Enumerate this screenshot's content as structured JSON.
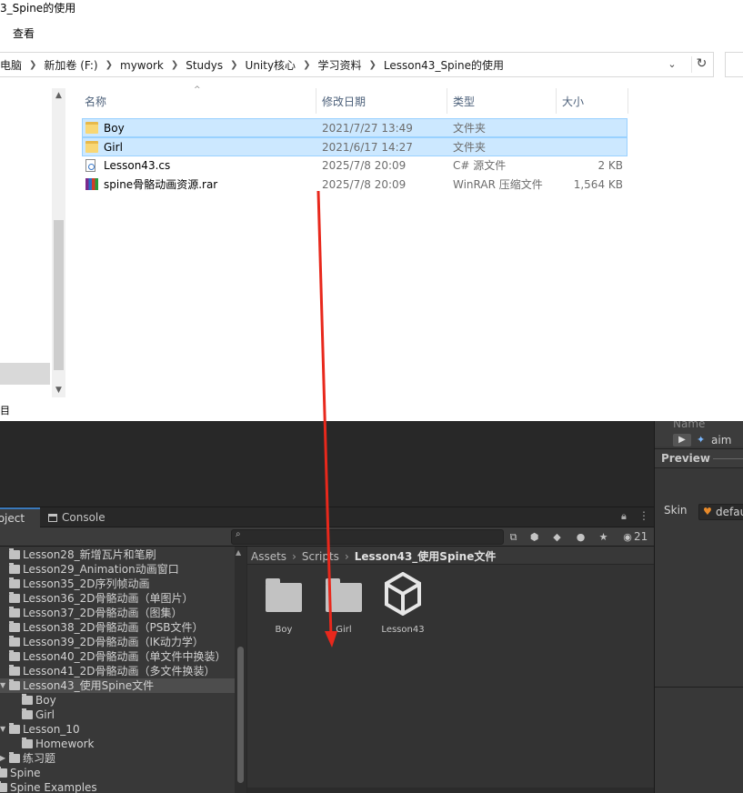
{
  "explorer": {
    "title": "3_Spine的使用",
    "menu": "查看",
    "breadcrumb": [
      "电脑",
      "新加卷 (F:)",
      "mywork",
      "Studys",
      "Unity核心",
      "学习资料",
      "Lesson43_Spine的使用"
    ],
    "status_left": "目",
    "columns": {
      "name": "名称",
      "date": "修改日期",
      "type": "类型",
      "size": "大小"
    },
    "files": [
      {
        "name": "Boy",
        "date": "2021/7/27 13:49",
        "type": "文件夹",
        "size": "",
        "icon": "folder-icon",
        "selected": true
      },
      {
        "name": "Girl",
        "date": "2021/6/17 14:27",
        "type": "文件夹",
        "size": "",
        "icon": "folder-icon",
        "selected": true
      },
      {
        "name": "Lesson43.cs",
        "date": "2025/7/8 20:09",
        "type": "C# 源文件",
        "size": "2 KB",
        "icon": "csharp-file-icon",
        "selected": false
      },
      {
        "name": "spine骨骼动画资源.rar",
        "date": "2025/7/8 20:09",
        "type": "WinRAR 压缩文件",
        "size": "1,564 KB",
        "icon": "rar-archive-icon",
        "selected": false
      }
    ]
  },
  "unity": {
    "inspector": {
      "name_label": "Name",
      "aim_label": "aim",
      "preview_label": "Preview",
      "skin_label": "Skin",
      "skin_value": "default"
    },
    "tabs": {
      "project": "Project",
      "console": "Console"
    },
    "hidden_count": "21",
    "tree": [
      {
        "label": "Lesson28_新增瓦片和笔刷",
        "indent": 0
      },
      {
        "label": "Lesson29_Animation动画窗口",
        "indent": 0
      },
      {
        "label": "Lesson35_2D序列帧动画",
        "indent": 0
      },
      {
        "label": "Lesson36_2D骨骼动画（单图片）",
        "indent": 0
      },
      {
        "label": "Lesson37_2D骨骼动画（图集）",
        "indent": 0
      },
      {
        "label": "Lesson38_2D骨骼动画（PSB文件）",
        "indent": 0
      },
      {
        "label": "Lesson39_2D骨骼动画（IK动力学）",
        "indent": 0
      },
      {
        "label": "Lesson40_2D骨骼动画（单文件中换装）",
        "indent": 0
      },
      {
        "label": "Lesson41_2D骨骼动画（多文件换装）",
        "indent": 0
      },
      {
        "label": "Lesson43_使用Spine文件",
        "indent": 0,
        "selected": true,
        "expanded": true
      },
      {
        "label": "Boy",
        "indent": 1
      },
      {
        "label": "Girl",
        "indent": 1
      },
      {
        "label": "Lesson_10",
        "indent": 0,
        "expanded": true
      },
      {
        "label": "Homework",
        "indent": 1
      },
      {
        "label": "练习题",
        "indent": 0,
        "collapsed": true
      },
      {
        "label": "Spine",
        "indent": -1
      },
      {
        "label": "Spine Examples",
        "indent": -1
      }
    ],
    "browser": {
      "breadcrumb": [
        "Assets",
        "Scripts",
        "Lesson43_使用Spine文件"
      ],
      "assets": [
        {
          "label": "Boy",
          "icon": "folder-icon"
        },
        {
          "label": "Girl",
          "icon": "folder-icon"
        },
        {
          "label": "Lesson43",
          "icon": "unity-logo-icon"
        }
      ]
    }
  }
}
